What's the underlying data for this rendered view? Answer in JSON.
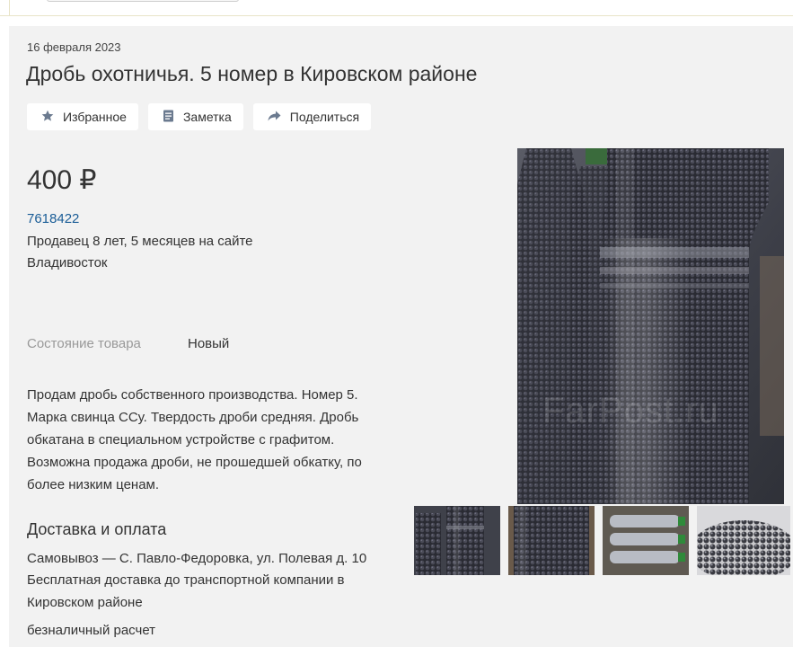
{
  "listing": {
    "date": "16 февраля 2023",
    "title": "Дробь охотничья. 5 номер в Кировском районе"
  },
  "actions": {
    "favorite": "Избранное",
    "note": "Заметка",
    "share": "Поделиться"
  },
  "price": "400 ₽",
  "seller": {
    "id": "7618422",
    "age": "Продавец 8 лет, 5 месяцев на сайте",
    "city": "Владивосток"
  },
  "condition": {
    "label": "Состояние товара",
    "value": "Новый"
  },
  "description": "Продам дробь собственного производства. Номер 5. Марка свинца ССу. Твердость дроби средняя. Дробь обкатана в специальном устройстве с графитом. Возможна продажа дроби, не прошедшей обкатку, по более низким ценам.",
  "delivery": {
    "title": "Доставка и оплата",
    "pickup": "Самовывоз — С. Павло-Федоровка, ул. Полевая д. 10",
    "free_delivery": "Бесплатная доставка до транспортной компании в Кировском районе",
    "payment": "безналичный расчет"
  },
  "photo": {
    "watermark": "FarPost.ru"
  },
  "icons": {
    "favorite": "star-icon",
    "note": "note-icon",
    "share": "share-arrow-icon"
  },
  "colors": {
    "link": "#1a5d97",
    "card_bg": "#f2f2f2",
    "muted": "#999999"
  }
}
